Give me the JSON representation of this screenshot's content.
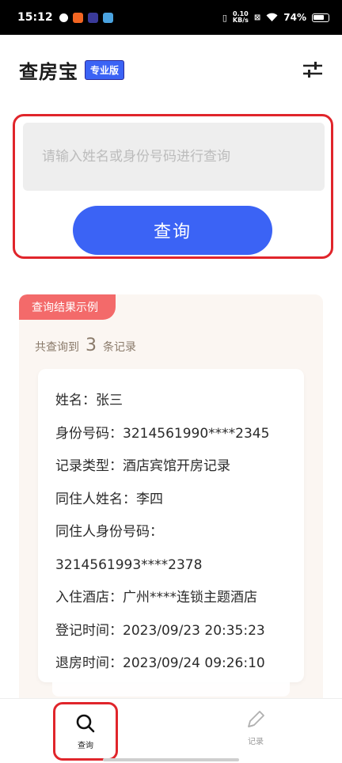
{
  "status_bar": {
    "time": "15:12",
    "network_speed_top": "0.10",
    "network_speed_unit": "KB/s",
    "battery_percent": "74%"
  },
  "header": {
    "title": "查房宝",
    "badge": "专业版",
    "filter_icon": "sliders-icon"
  },
  "search": {
    "placeholder": "请输入姓名或身份号码进行查询",
    "value": "",
    "button_label": "查询"
  },
  "result": {
    "tag": "查询结果示例",
    "count_prefix": "共查询到",
    "count": "3",
    "count_suffix": "条记录",
    "record": {
      "lines": [
        "姓名：张三",
        "身份号码：3214561990****2345",
        "记录类型：酒店宾馆开房记录",
        "同住人姓名：李四",
        "同住人身份号码：",
        "3214561993****2378",
        "入住酒店：广州****连锁主题酒店",
        "登记时间：2023/09/23 20:35:23",
        "退房时间：2023/09/24 09:26:10"
      ]
    }
  },
  "bottom_nav": {
    "items": [
      {
        "label": "查询",
        "icon": "search-icon",
        "active": true
      },
      {
        "label": "记录",
        "icon": "pencil-icon",
        "active": false
      }
    ]
  },
  "colors": {
    "accent": "#3b63f5",
    "highlight_border": "#e0252b",
    "tag_bg": "#f36a6a"
  }
}
